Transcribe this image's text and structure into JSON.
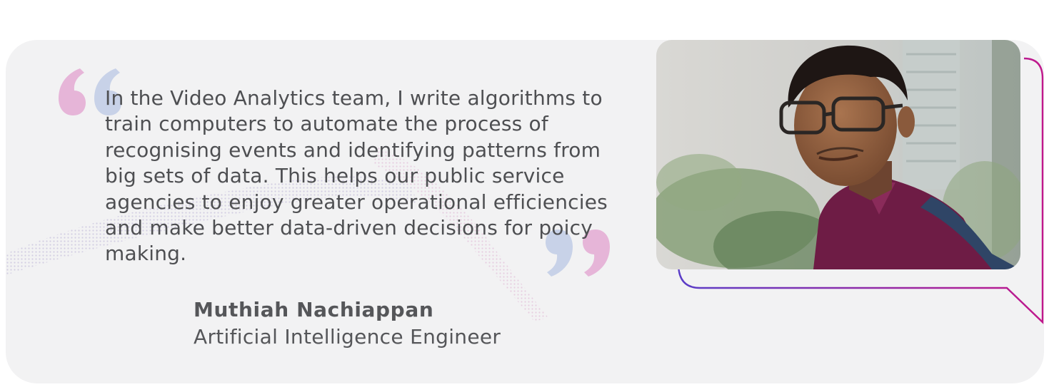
{
  "testimonial": {
    "quote": "In the Video Analytics team, I write algorithms to train computers to automate the process of recognising events and identifying patterns from big sets of data. This helps our public service agencies to enjoy greater operational efficiencies and make better data-driven decisions for poicy making.",
    "name": "Muthiah Nachiappan",
    "role": "Artificial Intelligence Engineer"
  },
  "colors": {
    "card_background": "#f2f2f3",
    "text": "#4e4f52",
    "quote_mark_pink": "#e6b5d8",
    "quote_mark_blue": "#c8d2e8",
    "bubble_outline_start": "#5a3dc7",
    "bubble_outline_end": "#c0188c",
    "shirt": "#6e1c45"
  },
  "icons": {
    "open_quote": "left-double-quote-icon",
    "close_quote": "right-double-quote-icon"
  }
}
